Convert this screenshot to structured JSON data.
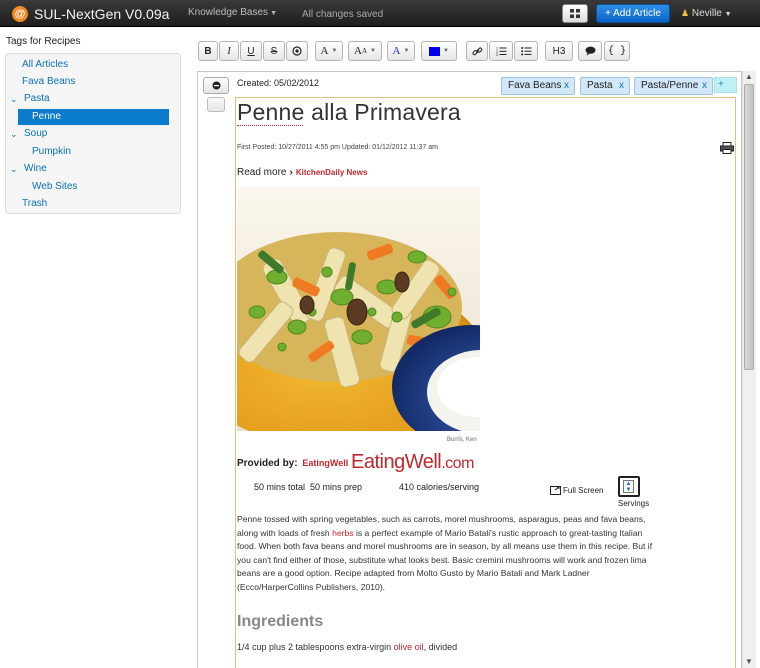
{
  "app": {
    "title": "SUL-NextGen V0.09a",
    "logo_char": "@"
  },
  "header": {
    "knowledge_bases": "Knowledge Bases",
    "status": "All changes saved",
    "add_article": "+ Add Article",
    "user": "Neville",
    "accent_color": "#0a63c9"
  },
  "sidebar": {
    "title": "Tags for Recipes",
    "items": [
      {
        "label": "All Articles",
        "level": 0,
        "expanded": null,
        "selected": false
      },
      {
        "label": "Fava Beans",
        "level": 0,
        "expanded": null,
        "selected": false
      },
      {
        "label": "Pasta",
        "level": 0,
        "expanded": true,
        "selected": false
      },
      {
        "label": "Penne",
        "level": 1,
        "expanded": null,
        "selected": true
      },
      {
        "label": "Soup",
        "level": 0,
        "expanded": true,
        "selected": false
      },
      {
        "label": "Pumpkin",
        "level": 1,
        "expanded": null,
        "selected": false
      },
      {
        "label": "Wine",
        "level": 0,
        "expanded": true,
        "selected": false
      },
      {
        "label": "Web Sites",
        "level": 1,
        "expanded": null,
        "selected": false
      },
      {
        "label": "Trash",
        "level": 0,
        "expanded": null,
        "selected": false
      }
    ]
  },
  "toolbar": {
    "bold": "B",
    "italic": "I",
    "underline": "U",
    "strike": "S",
    "font_color_label": "A",
    "font_size_label": "A",
    "highlight_label": "A",
    "heading": "H3",
    "code": "{ }",
    "block_color": "#0000ee"
  },
  "editor": {
    "created": "Created: 05/02/2012",
    "tags": [
      "Fava Beans",
      "Pasta",
      "Pasta/Penne"
    ],
    "tag_remove": "x",
    "tag_add": "+"
  },
  "article": {
    "title": "Penne alla Primavera",
    "dates": "First Posted: 10/27/2011 4:55 pm     Updated: 01/12/2012 11:37 am",
    "read_more": "Read more",
    "read_more_source": "KitchenDaily News",
    "photo_credit": "Burris, Ken",
    "provided_label": "Provided by:",
    "provided_name": "EatingWell",
    "logo_main": "EatingWell",
    "logo_suffix": ".com",
    "total_time": "50 mins total",
    "prep_time": "50 mins prep",
    "calories": "410 calories/serving",
    "full_screen": "Full Screen",
    "servings": "Servings",
    "para_1": "Penne tossed with spring vegetables, such as carrots, morel mushrooms, asparagus, peas and fava beans, along with loads of fresh ",
    "para_herbs": "herbs",
    "para_2": " is a perfect example of Mario Batali's rustic approach to great-tasting Italian food. When both fava beans and morel mushrooms are in season, by all means use them in this recipe. But if you can't find either of those, substitute what looks best. Basic cremini mushrooms will work and frozen lima beans are a good option. Recipe adapted from Molto Gusto by Mario Batali and Mark Ladner (Ecco/HarperCollins Publishers, 2010).",
    "ingredients_heading": "Ingredients",
    "ingredient_1_pre": "1/4 cup plus 2 tablespoons extra-virgin ",
    "ingredient_1_link": "olive oil",
    "ingredient_1_post": ", divided",
    "brand_red": "#c0282d"
  }
}
